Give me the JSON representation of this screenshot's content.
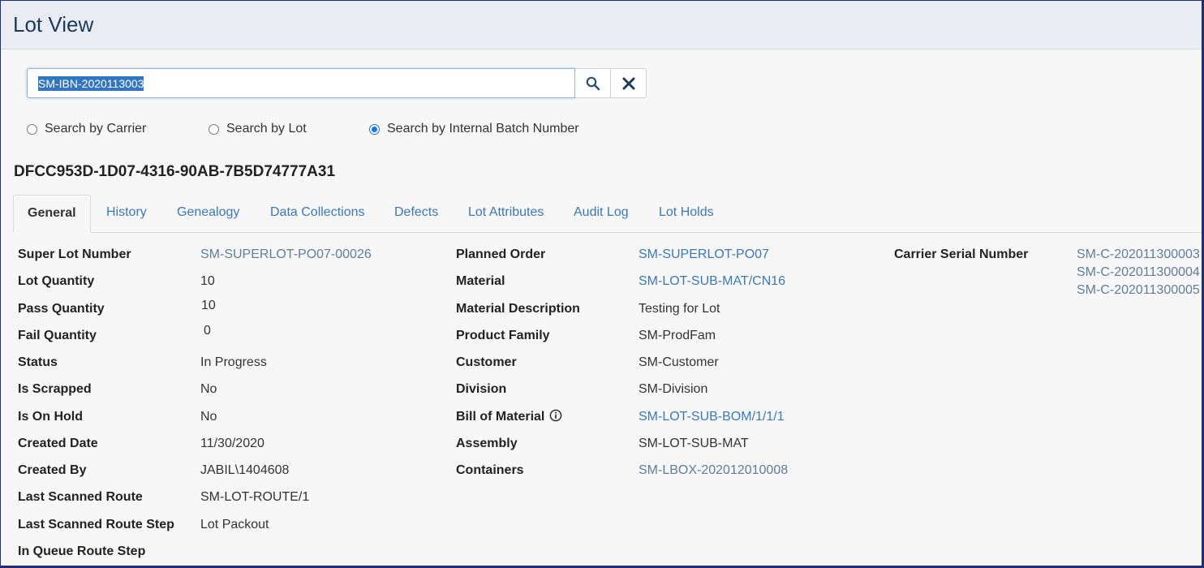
{
  "header": {
    "title": "Lot View"
  },
  "search": {
    "value": "SM-IBN-2020113003",
    "search_icon": "magnifier-icon",
    "clear_icon": "close-x-icon"
  },
  "search_options": [
    {
      "label": "Search by Carrier",
      "checked": false
    },
    {
      "label": "Search by Lot",
      "checked": false
    },
    {
      "label": "Search by Internal Batch Number",
      "checked": true
    }
  ],
  "lot_id": "DFCC953D-1D07-4316-90AB-7B5D74777A31",
  "tabs": [
    {
      "label": "General",
      "active": true
    },
    {
      "label": "History"
    },
    {
      "label": "Genealogy"
    },
    {
      "label": "Data Collections"
    },
    {
      "label": "Defects"
    },
    {
      "label": "Lot Attributes"
    },
    {
      "label": "Audit Log"
    },
    {
      "label": "Lot Holds"
    }
  ],
  "col1": [
    {
      "label": "Super Lot Number",
      "value": "SM-SUPERLOT-PO07-00026"
    },
    {
      "label": "Lot Quantity",
      "value": "10"
    },
    {
      "label": "Pass Quantity",
      "value": "10"
    },
    {
      "label": "Fail Quantity",
      "value": "0"
    },
    {
      "label": "Status",
      "value": "In Progress"
    },
    {
      "label": "Is Scrapped",
      "value": "No"
    },
    {
      "label": "Is On Hold",
      "value": "No"
    },
    {
      "label": "Created Date",
      "value": "11/30/2020"
    },
    {
      "label": "Created By",
      "value": "JABIL\\1404608"
    },
    {
      "label": "Last Scanned Route",
      "value": "SM-LOT-ROUTE/1"
    },
    {
      "label": "Last Scanned Route Step",
      "value": "Lot Packout"
    },
    {
      "label": "In Queue Route Step",
      "value": ""
    }
  ],
  "col2": [
    {
      "label": "Planned Order",
      "value": "SM-SUPERLOT-PO07"
    },
    {
      "label": "Material",
      "value": "SM-LOT-SUB-MAT/CN16"
    },
    {
      "label": "Material Description",
      "value": "Testing for Lot"
    },
    {
      "label": "Product Family",
      "value": "SM-ProdFam"
    },
    {
      "label": "Customer",
      "value": "SM-Customer"
    },
    {
      "label": "Division",
      "value": "SM-Division"
    },
    {
      "label": "Bill of Material",
      "value": "SM-LOT-SUB-BOM/1/1/1",
      "icon": "info-circle-icon"
    },
    {
      "label": "Assembly",
      "value": "SM-LOT-SUB-MAT"
    },
    {
      "label": "Containers",
      "value": "SM-LBOX-202012010008"
    }
  ],
  "col3": {
    "label": "Carrier Serial Number",
    "values": [
      "SM-C-202011300003",
      "SM-C-202011300004",
      "SM-C-202011300005"
    ]
  }
}
